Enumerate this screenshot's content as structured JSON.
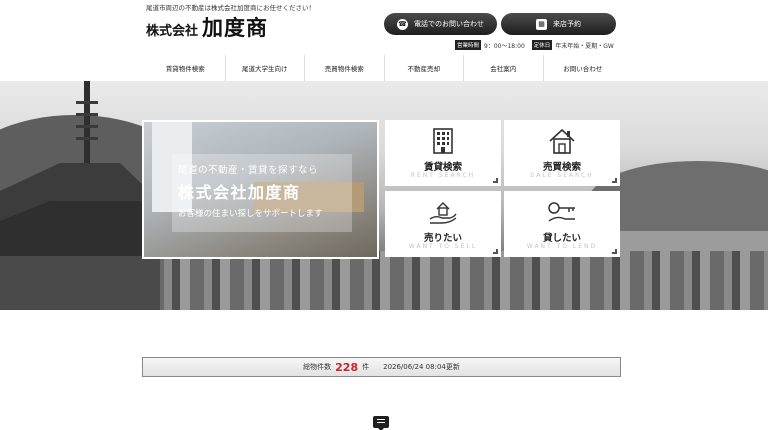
{
  "header": {
    "tagline": "尾道市周辺の不動産は株式会社加度商にお任せください！",
    "logo_prefix": "株式会社",
    "logo_name": "加度商",
    "tel_button": "電話でのお問い合わせ",
    "visit_button": "来店予約",
    "hours_tag": "営業時間",
    "hours": "9：00～18:00",
    "closed_tag": "定休日",
    "closed": "年末年始・夏期・GW"
  },
  "nav": {
    "items": [
      "賃貸物件検索",
      "尾道大学生向け",
      "売買物件検索",
      "不動産売却",
      "会社案内",
      "お問い合わせ"
    ]
  },
  "hero": {
    "line1": "尾道の不動産・賃貸を探すなら",
    "line2": "株式会社加度商",
    "line3": "お客様の住まい探しをサポートします"
  },
  "tiles": [
    {
      "jp": "賃貸検索",
      "en": "RENT SEARCH",
      "icon": "building-icon"
    },
    {
      "jp": "売買検索",
      "en": "SALE SEARCH",
      "icon": "house-icon"
    },
    {
      "jp": "売りたい",
      "en": "WANT TO SELL",
      "icon": "hand-house-icon"
    },
    {
      "jp": "貸したい",
      "en": "WANT TO LEND",
      "icon": "key-icon"
    }
  ],
  "listing_count": {
    "label": "総物件数",
    "count": "228",
    "unit": "件",
    "updated": "2026/06/24 08:04更新"
  },
  "colors": {
    "accent": "#c8252c",
    "button_dark": "#2a2a2a"
  }
}
